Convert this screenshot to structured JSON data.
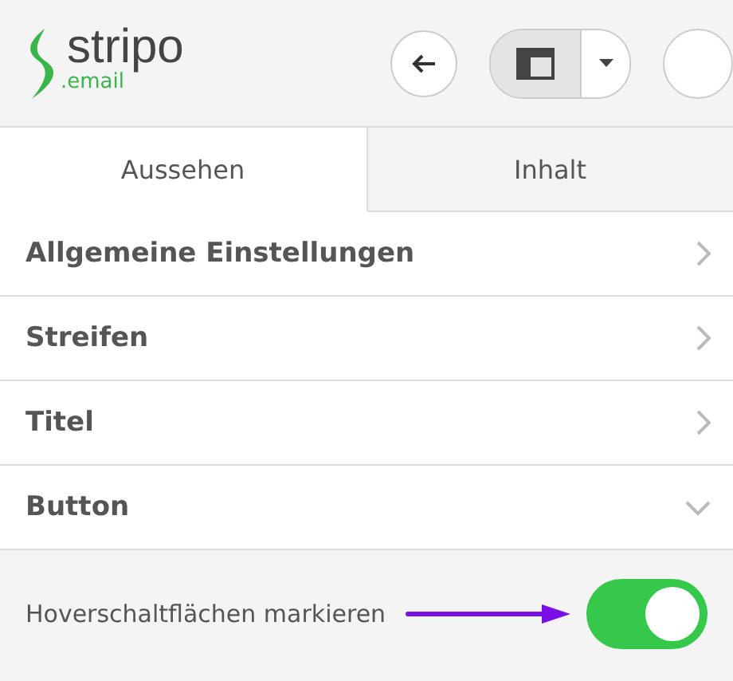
{
  "logo": {
    "name": "stripo",
    "domain": ".email"
  },
  "tabs": [
    {
      "label": "Aussehen",
      "selected": true
    },
    {
      "label": "Inhalt",
      "selected": false
    }
  ],
  "sections": [
    {
      "label": "Allgemeine Einstellungen",
      "expanded": false
    },
    {
      "label": "Streifen",
      "expanded": false
    },
    {
      "label": "Titel",
      "expanded": false
    },
    {
      "label": "Button",
      "expanded": true
    }
  ],
  "setting": {
    "label": "Hoverschaltflächen markieren",
    "on": true
  }
}
